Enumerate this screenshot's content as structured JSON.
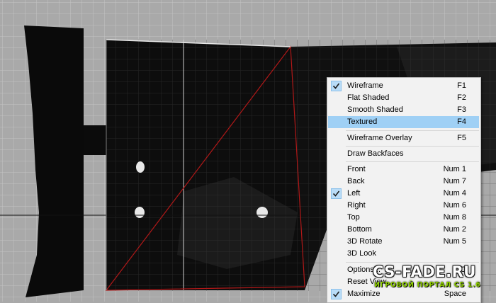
{
  "menu": {
    "items": [
      {
        "label": "Wireframe",
        "key": "F1",
        "checked": true,
        "selected": false
      },
      {
        "label": "Flat Shaded",
        "key": "F2",
        "checked": false,
        "selected": false
      },
      {
        "label": "Smooth Shaded",
        "key": "F3",
        "checked": false,
        "selected": false
      },
      {
        "label": "Textured",
        "key": "F4",
        "checked": false,
        "selected": true
      },
      {
        "label": "Wireframe Overlay",
        "key": "F5",
        "checked": false,
        "selected": false
      },
      {
        "label": "Draw Backfaces",
        "key": "",
        "checked": false,
        "selected": false
      },
      {
        "label": "Front",
        "key": "Num 1",
        "checked": false,
        "selected": false
      },
      {
        "label": "Back",
        "key": "Num 7",
        "checked": false,
        "selected": false
      },
      {
        "label": "Left",
        "key": "Num 4",
        "checked": true,
        "selected": false
      },
      {
        "label": "Right",
        "key": "Num 6",
        "checked": false,
        "selected": false
      },
      {
        "label": "Top",
        "key": "Num 8",
        "checked": false,
        "selected": false
      },
      {
        "label": "Bottom",
        "key": "Num 2",
        "checked": false,
        "selected": false
      },
      {
        "label": "3D Rotate",
        "key": "Num 5",
        "checked": false,
        "selected": false
      },
      {
        "label": "3D Look",
        "key": "",
        "checked": false,
        "selected": false
      },
      {
        "label": "Options...",
        "key": "O",
        "checked": false,
        "selected": false
      },
      {
        "label": "Reset View",
        "key": "",
        "checked": false,
        "selected": false
      },
      {
        "label": "Maximize",
        "key": "Space",
        "checked": true,
        "selected": false
      }
    ]
  },
  "watermark": {
    "title": "CS-FADE.RU",
    "subtitle": "ИГРОВОЙ ПОРТАЛ CS 1.6"
  },
  "colors": {
    "viewport_background": "#a9a9a9",
    "grid": "#c4c4c4",
    "wire": "#b01818",
    "selection_highlight": "#9fd0f5",
    "check_box": "#b9dcf7",
    "watermark_subtitle": "#8fd000"
  },
  "icons": {
    "check": "check-icon"
  }
}
